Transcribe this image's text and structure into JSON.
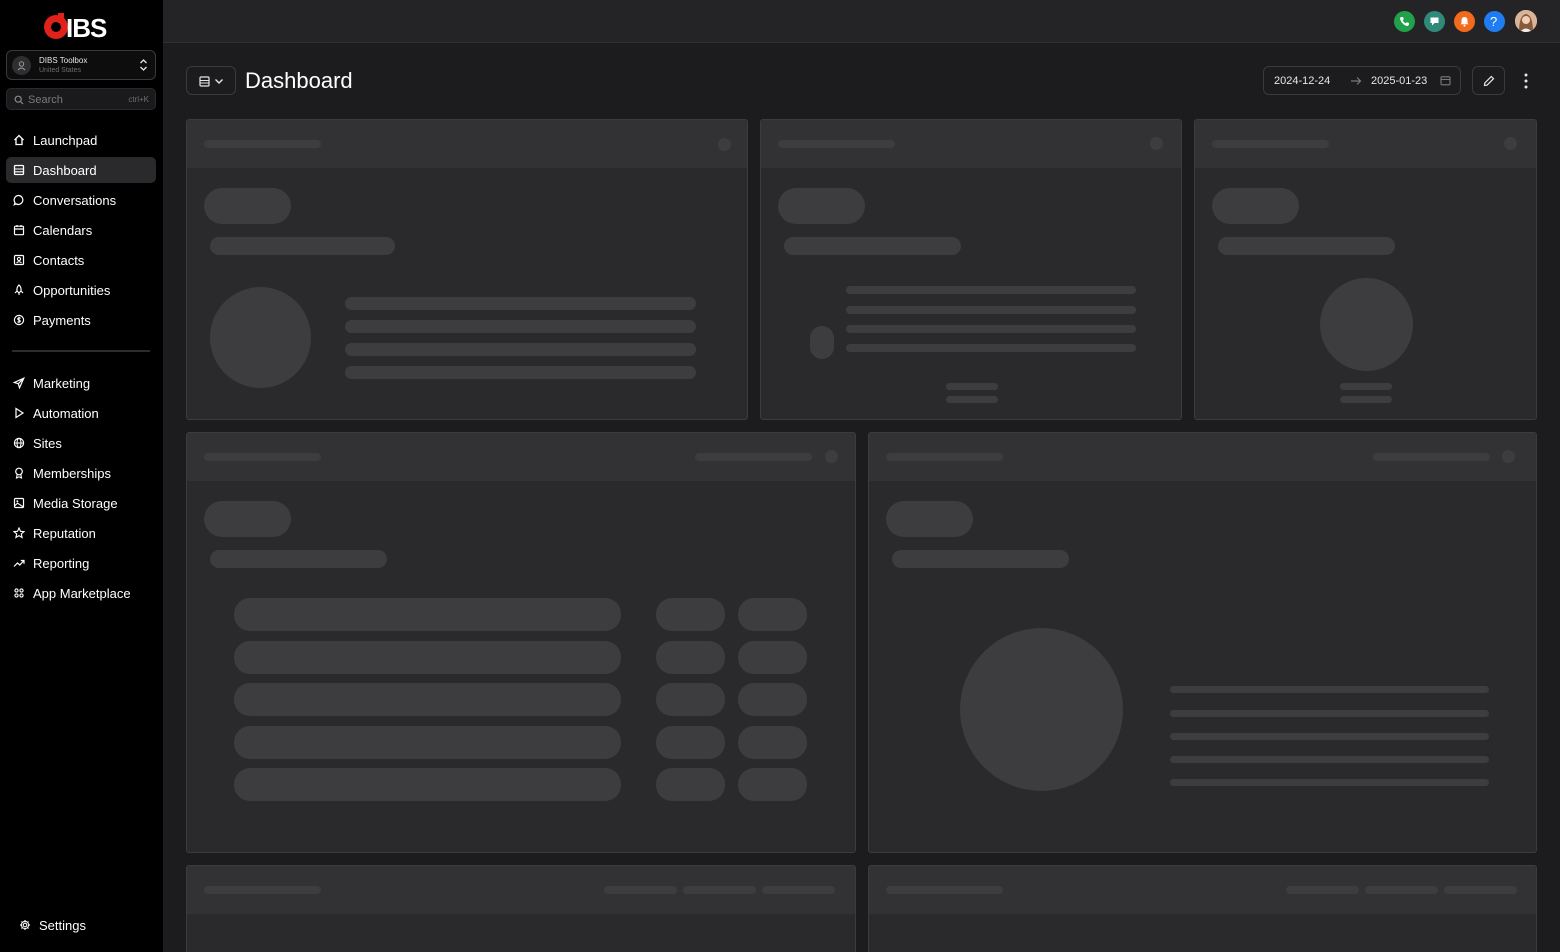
{
  "brand": {
    "logo_text": "DIBS",
    "accent": "#e0221b"
  },
  "account": {
    "name": "DIBS Toolbox",
    "location": "United States"
  },
  "search": {
    "placeholder": "Search",
    "shortcut": "ctrl+K"
  },
  "nav": {
    "primary": [
      {
        "label": "Launchpad",
        "icon": "home-icon"
      },
      {
        "label": "Dashboard",
        "icon": "dashboard-icon",
        "active": true
      },
      {
        "label": "Conversations",
        "icon": "chat-icon"
      },
      {
        "label": "Calendars",
        "icon": "calendar-icon"
      },
      {
        "label": "Contacts",
        "icon": "contacts-icon"
      },
      {
        "label": "Opportunities",
        "icon": "opportunities-icon"
      },
      {
        "label": "Payments",
        "icon": "payments-icon"
      }
    ],
    "secondary": [
      {
        "label": "Marketing",
        "icon": "send-icon"
      },
      {
        "label": "Automation",
        "icon": "play-icon"
      },
      {
        "label": "Sites",
        "icon": "globe-icon"
      },
      {
        "label": "Memberships",
        "icon": "award-icon"
      },
      {
        "label": "Media Storage",
        "icon": "image-icon"
      },
      {
        "label": "Reputation",
        "icon": "star-icon"
      },
      {
        "label": "Reporting",
        "icon": "trending-up-icon"
      },
      {
        "label": "App Marketplace",
        "icon": "grid-icon"
      }
    ],
    "settings": {
      "label": "Settings",
      "icon": "gear-icon"
    }
  },
  "topbar": {
    "icons": [
      {
        "name": "phone-icon",
        "color": "#1fa24a"
      },
      {
        "name": "announcement-icon",
        "color": "#2f8a7a"
      },
      {
        "name": "notification-icon",
        "color": "#f26b1d"
      },
      {
        "name": "help-icon",
        "color": "#1f7cf2"
      }
    ],
    "help_glyph": "?"
  },
  "header": {
    "title": "Dashboard",
    "date_start": "2024-12-24",
    "date_end": "2025-01-23"
  }
}
